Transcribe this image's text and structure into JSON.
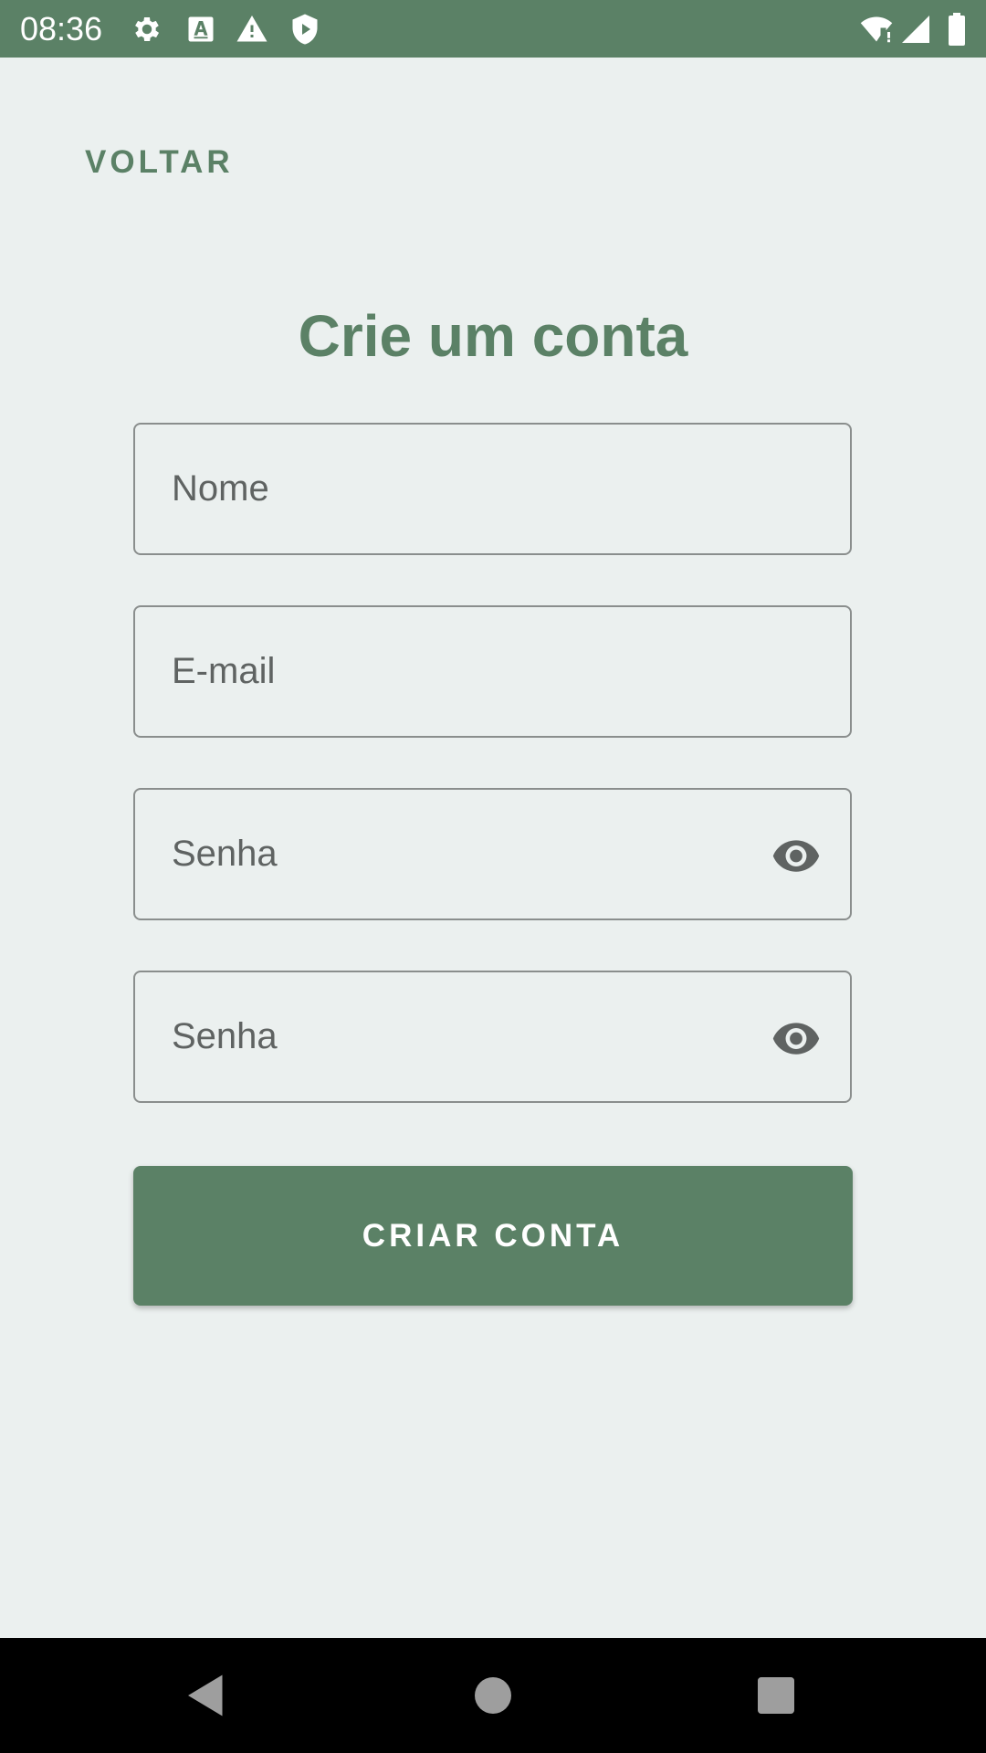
{
  "status_bar": {
    "time": "08:36",
    "left_icons": [
      "gear-icon",
      "font-a-icon",
      "warning-icon",
      "shield-play-icon"
    ],
    "right_icons": [
      "wifi-alert-icon",
      "cell-signal-icon",
      "battery-icon"
    ]
  },
  "header": {
    "back_label": "VOLTAR"
  },
  "main": {
    "title": "Crie um conta",
    "fields": {
      "name": {
        "placeholder": "Nome",
        "value": ""
      },
      "email": {
        "placeholder": "E-mail",
        "value": ""
      },
      "password": {
        "placeholder": "Senha",
        "value": "",
        "toggle_icon": "eye-icon"
      },
      "confirm_password": {
        "placeholder": "Senha",
        "value": "",
        "toggle_icon": "eye-icon"
      }
    },
    "submit_label": "CRIAR CONTA"
  },
  "nav_bar": {
    "buttons": [
      "back-triangle-icon",
      "home-circle-icon",
      "recents-square-icon"
    ]
  },
  "colors": {
    "accent": "#5B8166",
    "background": "#EBF0EF",
    "field_border": "#8A8E8D",
    "placeholder_text": "#5F6362",
    "icon_gray": "#5F6362",
    "nav_bar": "#000000"
  }
}
